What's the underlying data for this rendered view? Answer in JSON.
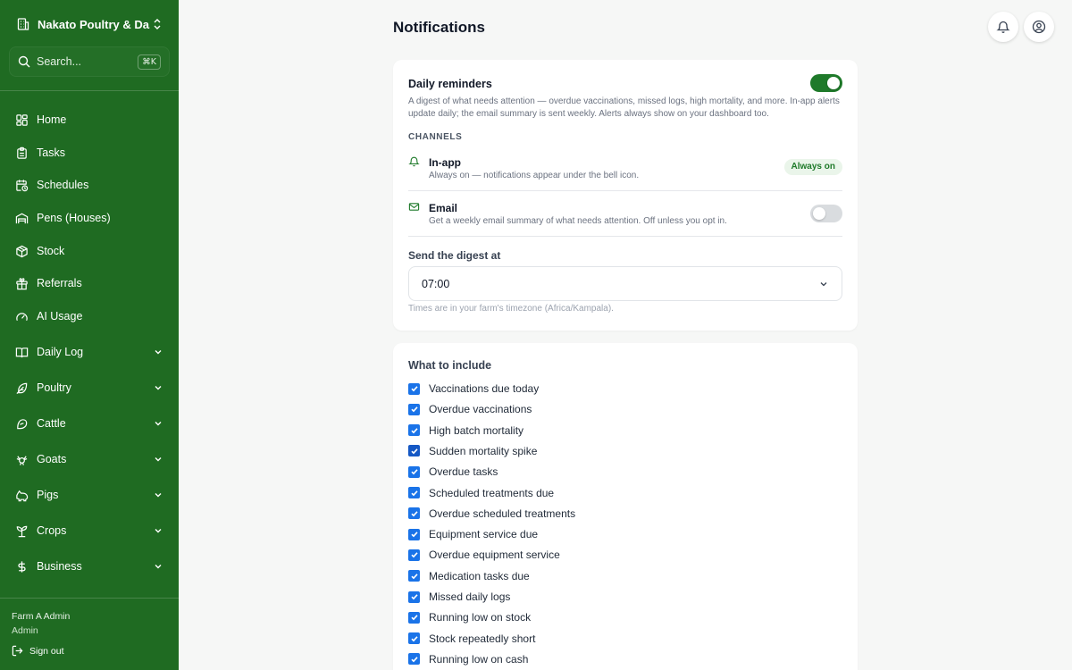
{
  "sidebar": {
    "farm_name": "Nakato Poultry & Da...",
    "search": {
      "label": "Search...",
      "shortcut": "⌘K"
    },
    "items": [
      {
        "label": "Home",
        "icon": "grid-icon"
      },
      {
        "label": "Tasks",
        "icon": "clipboard-icon"
      },
      {
        "label": "Schedules",
        "icon": "calendar-clock-icon"
      },
      {
        "label": "Pens (Houses)",
        "icon": "warehouse-icon"
      },
      {
        "label": "Stock",
        "icon": "package-icon"
      },
      {
        "label": "Referrals",
        "icon": "gift-icon"
      },
      {
        "label": "AI Usage",
        "icon": "gauge-icon"
      }
    ],
    "groups": [
      {
        "label": "Daily Log",
        "icon": "book-icon"
      },
      {
        "label": "Poultry",
        "icon": "feather-icon"
      },
      {
        "label": "Cattle",
        "icon": "cattle-icon"
      },
      {
        "label": "Goats",
        "icon": "goat-icon"
      },
      {
        "label": "Pigs",
        "icon": "pig-icon"
      },
      {
        "label": "Crops",
        "icon": "sprout-icon"
      },
      {
        "label": "Business",
        "icon": "dollar-icon"
      }
    ],
    "footer": {
      "user": "Farm A Admin",
      "role": "Admin",
      "sign_out": "Sign out"
    }
  },
  "header": {
    "title": "Notifications"
  },
  "daily_reminders": {
    "title": "Daily reminders",
    "enabled": true,
    "description": "A digest of what needs attention — overdue vaccinations, missed logs, high mortality, and more. In-app alerts update daily; the email summary is sent weekly. Alerts always show on your dashboard too.",
    "channels_heading": "CHANNELS",
    "channels": [
      {
        "name": "In-app",
        "description": "Always on — notifications appear under the bell icon.",
        "badge": "Always on"
      },
      {
        "name": "Email",
        "description": "Get a weekly email summary of what needs attention. Off unless you opt in.",
        "enabled": false
      }
    ],
    "send_label": "Send the digest at",
    "send_time": "07:00",
    "timezone_note": "Times are in your farm's timezone (Africa/Kampala)."
  },
  "include": {
    "title": "What to include",
    "items": [
      "Vaccinations due today",
      "Overdue vaccinations",
      "High batch mortality",
      "Sudden mortality spike",
      "Overdue tasks",
      "Scheduled treatments due",
      "Overdue scheduled treatments",
      "Equipment service due",
      "Overdue equipment service",
      "Medication tasks due",
      "Missed daily logs",
      "Running low on stock",
      "Stock repeatedly short",
      "Running low on cash"
    ]
  },
  "colors": {
    "sidebar": "#1f6b22",
    "accent": "#1f7a2a",
    "checkbox": "#1a73e8"
  }
}
